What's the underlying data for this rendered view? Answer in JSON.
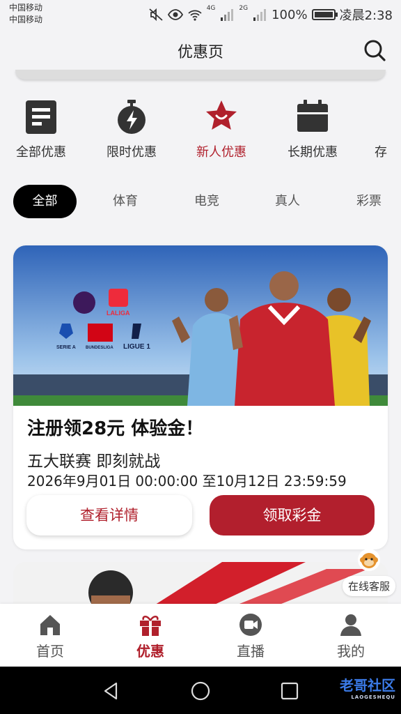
{
  "status_bar": {
    "carrier_1": "中国移动",
    "carrier_2": "中国移动",
    "signal_1": "4G",
    "signal_2": "2G",
    "battery": "100%",
    "time": "凌晨2:38"
  },
  "header": {
    "title": "优惠页",
    "search_icon": "search-icon"
  },
  "categories": [
    {
      "label": "全部优惠",
      "icon": "document-icon",
      "active": false
    },
    {
      "label": "限时优惠",
      "icon": "stopwatch-icon",
      "active": false
    },
    {
      "label": "新人优惠",
      "icon": "star-icon",
      "active": true
    },
    {
      "label": "长期优惠",
      "icon": "calendar-icon",
      "active": false
    },
    {
      "label": "存",
      "icon": "",
      "active": false
    }
  ],
  "filter_tabs": [
    {
      "label": "全部",
      "active": true
    },
    {
      "label": "体育",
      "active": false
    },
    {
      "label": "电竞",
      "active": false
    },
    {
      "label": "真人",
      "active": false
    },
    {
      "label": "彩票",
      "active": false
    }
  ],
  "promo": {
    "banner_logos": [
      "LALIGA",
      "SERIE A",
      "BUNDESLIGA",
      "LIGUE 1"
    ],
    "title": "注册领28元 体验金！",
    "subtitle": "五大联赛 即刻就战",
    "period": "2026年9月01日 00:00:00 至10月12日 23:59:59",
    "detail_button": "查看详情",
    "claim_button": "领取彩金"
  },
  "customer_service": {
    "label": "在线客服"
  },
  "bottom_nav": [
    {
      "label": "首页",
      "icon": "home-icon",
      "active": false
    },
    {
      "label": "优惠",
      "icon": "gift-icon",
      "active": true
    },
    {
      "label": "直播",
      "icon": "video-icon",
      "active": false
    },
    {
      "label": "我的",
      "icon": "user-icon",
      "active": false
    }
  ],
  "watermark": {
    "text": "老哥社区",
    "small": "LAOGESHEQU"
  },
  "colors": {
    "accent": "#b0202c",
    "claim_button": "#b21f2d",
    "background": "#f3f3f5"
  }
}
